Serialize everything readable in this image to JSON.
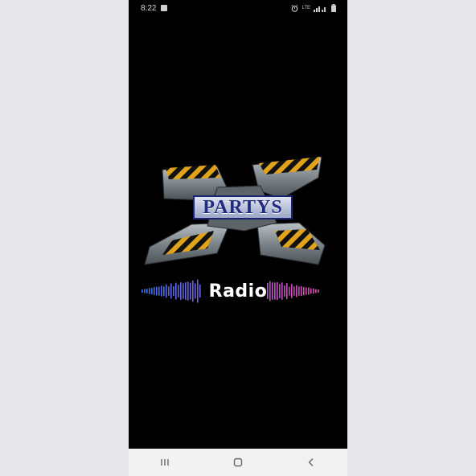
{
  "status_bar": {
    "time": "8:22",
    "network_label": "LTE",
    "icons": [
      "alarm-icon",
      "signal-icon",
      "battery-icon"
    ]
  },
  "splash": {
    "logo_text": "PARTYS",
    "logo_letter": "X",
    "subtitle": "Radio"
  },
  "nav_bar": {
    "buttons": [
      "recent-apps",
      "home",
      "back"
    ]
  },
  "colors": {
    "background": "#000000",
    "hazard_yellow": "#e0a31a",
    "metal": "#8d9499",
    "logo_text": "#1f2b83",
    "wave_start": "#3b6ff0",
    "wave_end": "#e04bb0",
    "nav_bar_bg": "#f2f2f2"
  }
}
